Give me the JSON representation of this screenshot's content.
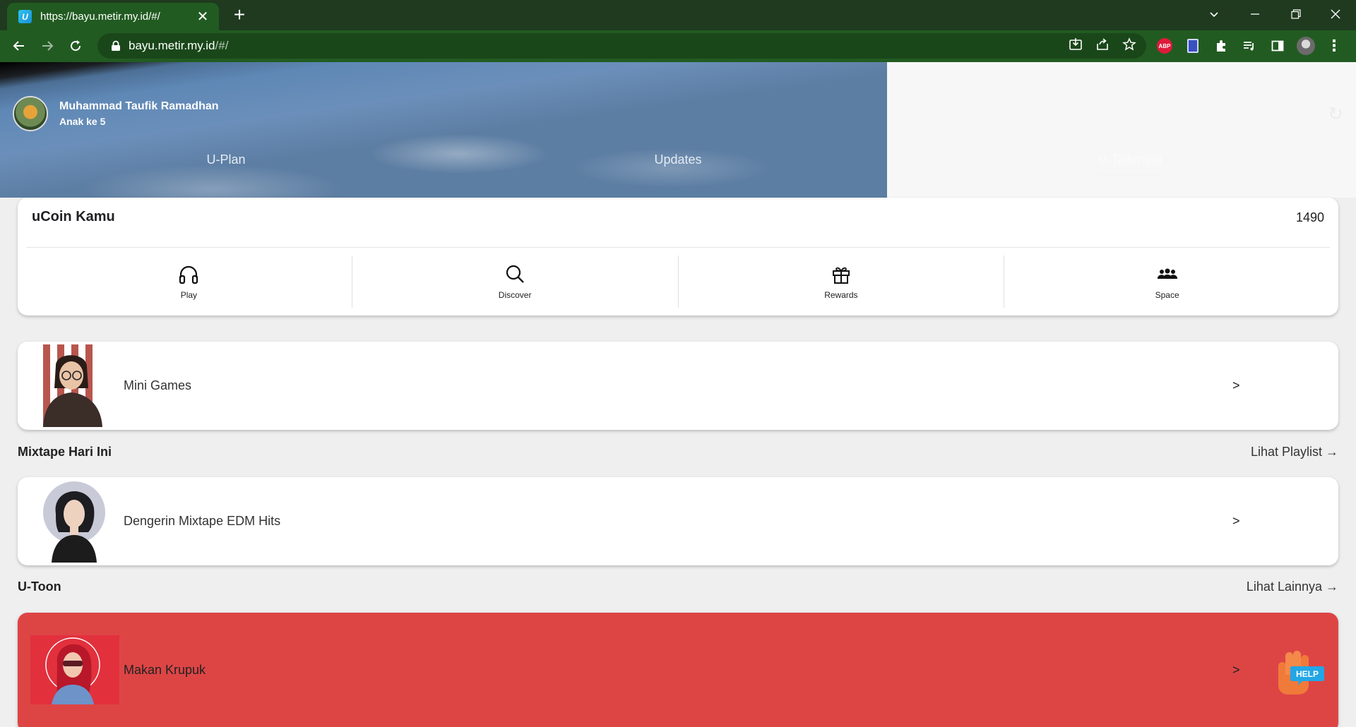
{
  "browser": {
    "tab_title": "https://bayu.metir.my.id/#/",
    "tab_close": "✕",
    "new_tab": "+",
    "url_host": "bayu.metir.my.id",
    "url_path": "/#/"
  },
  "profile": {
    "name": "Muhammad Taufik Ramadhan",
    "subtitle": "Anak ke 5"
  },
  "nav_tabs": [
    {
      "label": "U-Plan"
    },
    {
      "label": "Updates"
    },
    {
      "label": "U-Talkment"
    }
  ],
  "ucoin": {
    "title": "uCoin Kamu",
    "value": "1490",
    "actions": [
      {
        "label": "Play",
        "icon": "headphones-icon"
      },
      {
        "label": "Discover",
        "icon": "search-icon"
      },
      {
        "label": "Rewards",
        "icon": "gift-icon"
      },
      {
        "label": "Space",
        "icon": "group-icon"
      }
    ]
  },
  "mini_games": {
    "title": "Mini Games",
    "chevron": ">"
  },
  "mixtape": {
    "section_title": "Mixtape Hari Ini",
    "link": "Lihat Playlist →",
    "item_title": "Dengerin Mixtape EDM Hits",
    "chevron": ">"
  },
  "utoon": {
    "section_title": "U-Toon",
    "link": "Lihat Lainnya →",
    "item_title": "Makan Krupuk",
    "chevron": ">"
  },
  "help_button": {
    "label": "HELP"
  },
  "colors": {
    "chrome_bg": "#225b22",
    "titlebar_bg": "#1f3a1f",
    "utoon_card": "#dd4545",
    "page_bg": "#efefef"
  }
}
